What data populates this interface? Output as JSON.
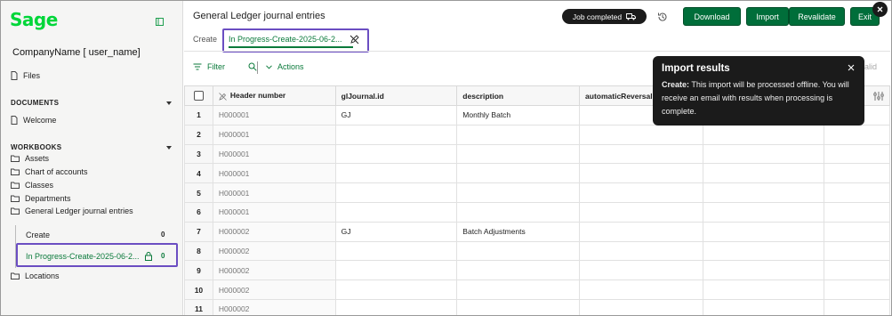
{
  "sidebar": {
    "logo": "Sage",
    "company": "CompanyName [ user_name]",
    "files_label": "Files",
    "documents_heading": "DOCUMENTS",
    "welcome_label": "Welcome",
    "workbooks_heading": "WORKBOOKS",
    "workbooks": [
      "Assets",
      "Chart of accounts",
      "Classes",
      "Departments",
      "General Ledger journal entries"
    ],
    "create_label": "Create",
    "create_count": "0",
    "inprogress_label": "In Progress-Create-2025-06-2...",
    "inprogress_count": "0",
    "locations_label": "Locations"
  },
  "header": {
    "title": "General Ledger journal entries",
    "create_label": "Create",
    "active_tab": "In Progress-Create-2025-06-2...",
    "job_status": "Job completed",
    "buttons": {
      "download": "Download",
      "import": "Import",
      "revalidate": "Revalidate",
      "exit": "Exit"
    }
  },
  "toolbar": {
    "filter": "Filter",
    "actions": "Actions",
    "valid_ghost": "alid"
  },
  "grid": {
    "columns": [
      "Header number",
      "glJournal.id",
      "description",
      "automaticReversalDa"
    ],
    "rows": [
      {
        "n": "1",
        "header": "H000001",
        "journal": "GJ",
        "desc": "Monthly Batch"
      },
      {
        "n": "2",
        "header": "H000001",
        "journal": "",
        "desc": ""
      },
      {
        "n": "3",
        "header": "H000001",
        "journal": "",
        "desc": ""
      },
      {
        "n": "4",
        "header": "H000001",
        "journal": "",
        "desc": ""
      },
      {
        "n": "5",
        "header": "H000001",
        "journal": "",
        "desc": ""
      },
      {
        "n": "6",
        "header": "H000001",
        "journal": "",
        "desc": ""
      },
      {
        "n": "7",
        "header": "H000002",
        "journal": "GJ",
        "desc": "Batch Adjustments"
      },
      {
        "n": "8",
        "header": "H000002",
        "journal": "",
        "desc": ""
      },
      {
        "n": "9",
        "header": "H000002",
        "journal": "",
        "desc": ""
      },
      {
        "n": "10",
        "header": "H000002",
        "journal": "",
        "desc": ""
      },
      {
        "n": "11",
        "header": "H000002",
        "journal": "",
        "desc": ""
      }
    ]
  },
  "toast": {
    "title": "Import results",
    "body_bold": "Create:",
    "body_text": " This import will be processed offline. You will receive an email with results when processing is complete."
  },
  "colors": {
    "brand_green": "#00d639",
    "button_green": "#006e3a",
    "link_green": "#0b7a3b",
    "highlight_purple": "#6b4ec2",
    "toast_bg": "#1b1b1b"
  }
}
